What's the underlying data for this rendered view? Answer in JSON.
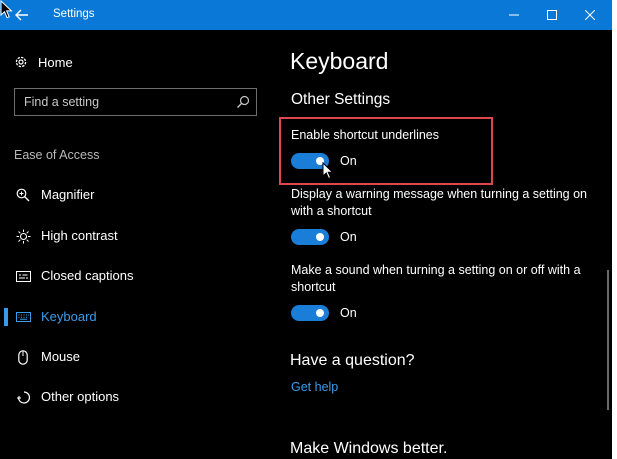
{
  "window": {
    "title": "Settings",
    "titlebar_color": "#0a78d7",
    "controls": {
      "back": "back-arrow-icon",
      "minimize": "minimize-icon",
      "maximize": "maximize-icon",
      "close": "close-icon"
    }
  },
  "sidebar": {
    "home_label": "Home",
    "search_placeholder": "Find a setting",
    "section_label": "Ease of Access",
    "items": [
      {
        "label": "Magnifier",
        "icon": "magnifier-icon"
      },
      {
        "label": "High contrast",
        "icon": "contrast-sun-icon"
      },
      {
        "label": "Closed captions",
        "icon": "closed-captions-icon"
      },
      {
        "label": "Keyboard",
        "icon": "keyboard-icon",
        "active": true
      },
      {
        "label": "Mouse",
        "icon": "mouse-icon"
      },
      {
        "label": "Other options",
        "icon": "other-options-icon"
      }
    ]
  },
  "main": {
    "title": "Keyboard",
    "section": "Other Settings",
    "settings": [
      {
        "label": "Enable shortcut underlines",
        "state": "On",
        "on": true,
        "highlighted": true
      },
      {
        "label": "Display a warning message when turning a setting on with a shortcut",
        "state": "On",
        "on": true
      },
      {
        "label": "Make a sound when turning a setting on or off with a shortcut",
        "state": "On",
        "on": true
      }
    ],
    "question_heading": "Have a question?",
    "help_link": "Get help",
    "feedback_heading": "Make Windows better."
  },
  "colors": {
    "accent": "#1a7ed8",
    "link": "#3a9bea",
    "highlight_border": "#e0474c",
    "background": "#000000"
  }
}
